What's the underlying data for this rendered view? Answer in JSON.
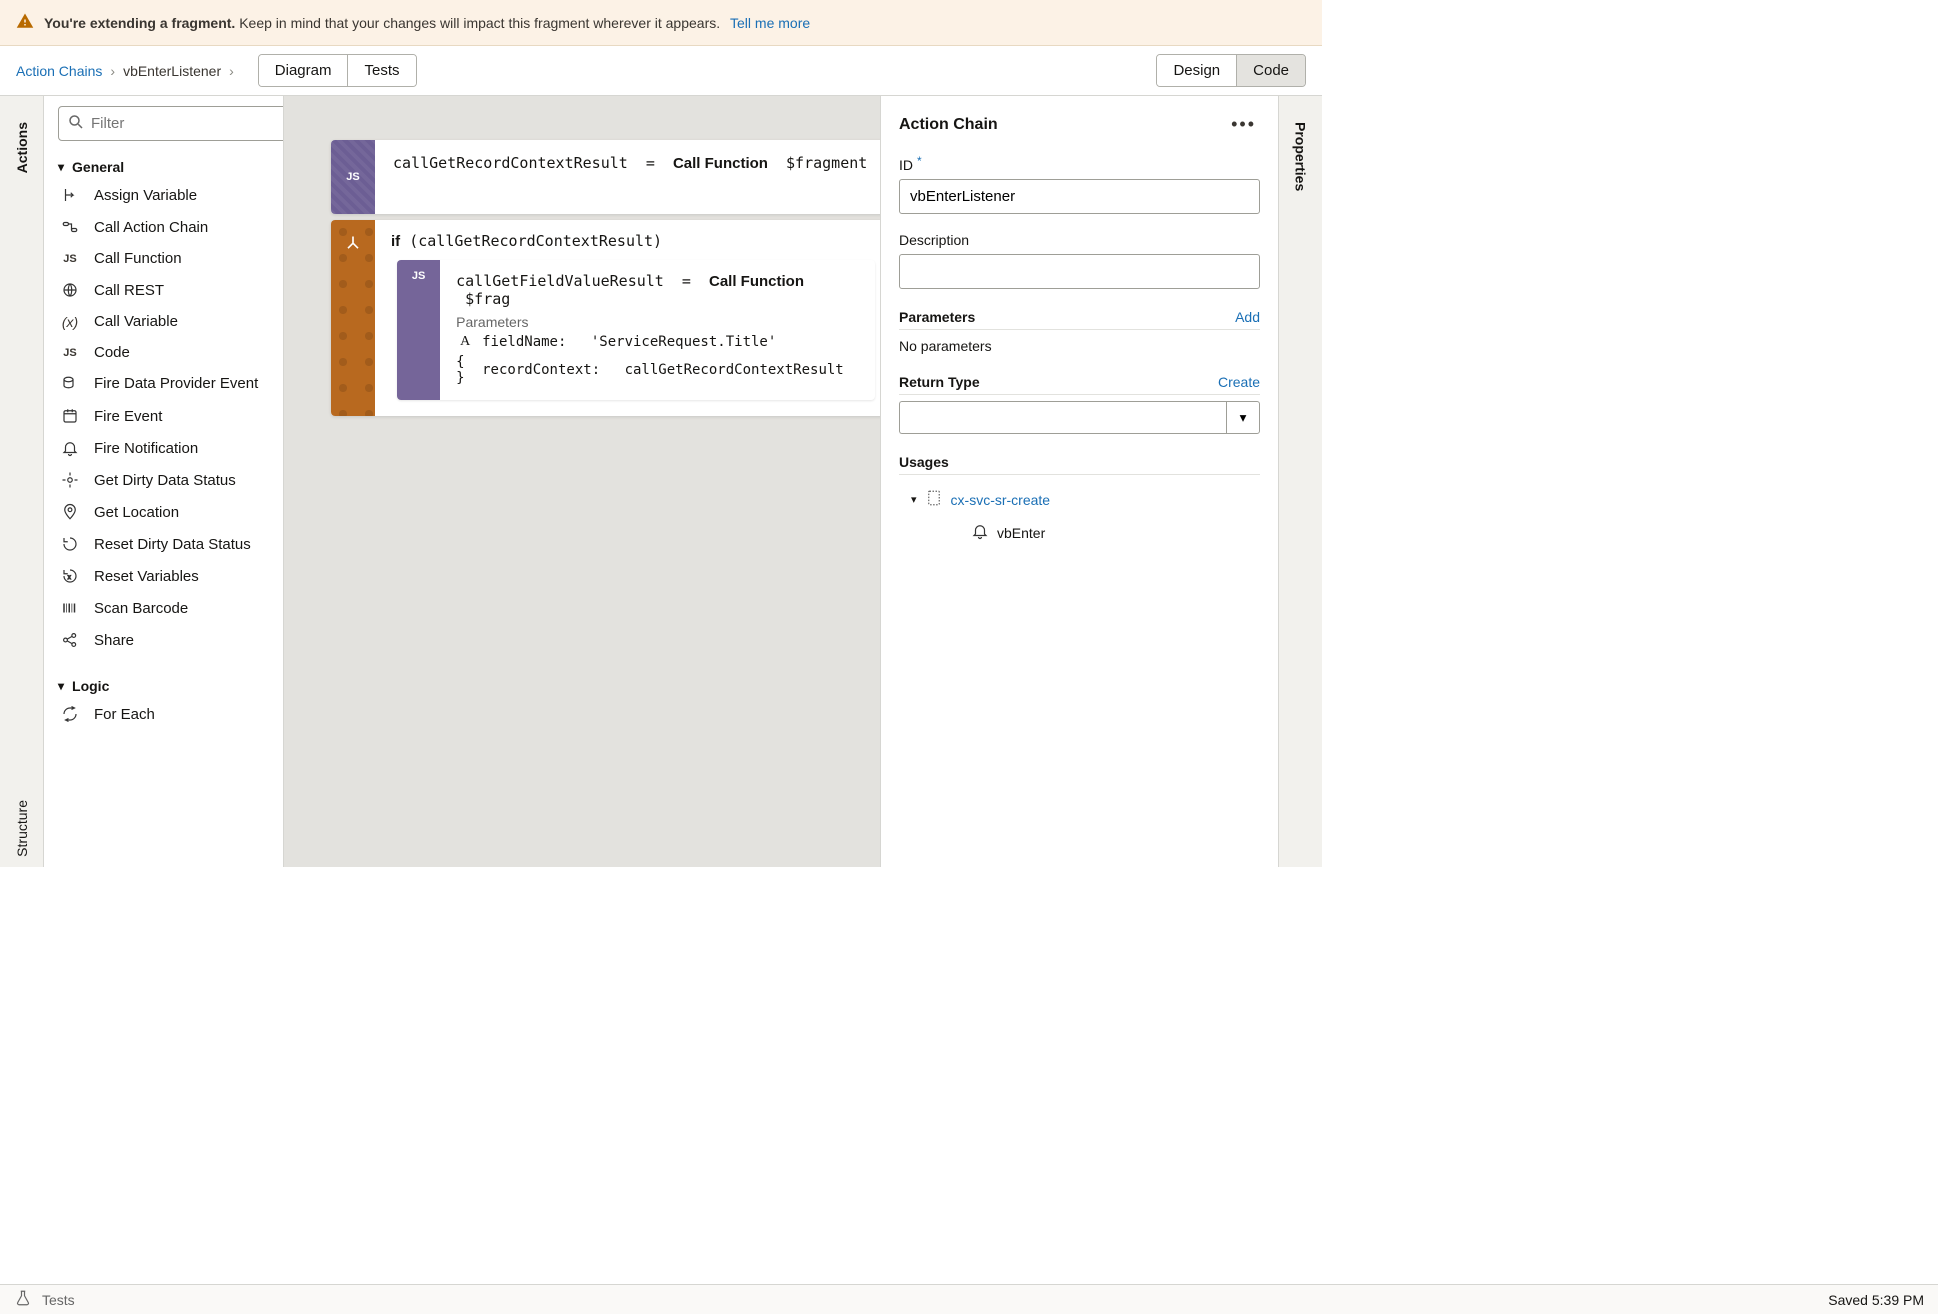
{
  "banner": {
    "bold": "You're extending a fragment.",
    "text": "Keep in mind that your changes will impact this fragment wherever it appears.",
    "link": "Tell me more"
  },
  "header": {
    "breadcrumb_root": "Action Chains",
    "breadcrumb_current": "vbEnterListener",
    "tabs_left": {
      "diagram": "Diagram",
      "tests": "Tests"
    },
    "tabs_right": {
      "design": "Design",
      "code": "Code"
    }
  },
  "rails": {
    "left_actions": "Actions",
    "left_structure": "Structure",
    "right_properties": "Properties"
  },
  "actions_panel": {
    "filter_placeholder": "Filter",
    "cat_general": "General",
    "cat_logic": "Logic",
    "items_general": [
      "Assign Variable",
      "Call Action Chain",
      "Call Function",
      "Call REST",
      "Call Variable",
      "Code",
      "Fire Data Provider Event",
      "Fire Event",
      "Fire Notification",
      "Get Dirty Data Status",
      "Get Location",
      "Reset Dirty Data Status",
      "Reset Variables",
      "Scan Barcode",
      "Share"
    ],
    "items_logic": [
      "For Each"
    ]
  },
  "canvas": {
    "block1_var": "callGetRecordContextResult",
    "block1_eq": "=",
    "block1_call": "Call Function",
    "block1_target": "$fragment",
    "if_kw": "if",
    "if_cond": "(callGetRecordContextResult)",
    "inner_var": "callGetFieldValueResult",
    "inner_eq": "=",
    "inner_call": "Call Function",
    "inner_target": "$frag",
    "params_label": "Parameters",
    "param1_key": "fieldName:",
    "param1_val": "'ServiceRequest.Title'",
    "param2_key": "recordContext:",
    "param2_val": "callGetRecordContextResult"
  },
  "props": {
    "title": "Action Chain",
    "id_label": "ID",
    "id_value": "vbEnterListener",
    "desc_label": "Description",
    "desc_value": "",
    "params_label": "Parameters",
    "params_add": "Add",
    "no_params": "No parameters",
    "return_label": "Return Type",
    "return_create": "Create",
    "usages_label": "Usages",
    "usage_link": "cx-svc-sr-create",
    "usage_sub": "vbEnter"
  },
  "footer": {
    "tests": "Tests",
    "saved": "Saved 5:39 PM"
  }
}
